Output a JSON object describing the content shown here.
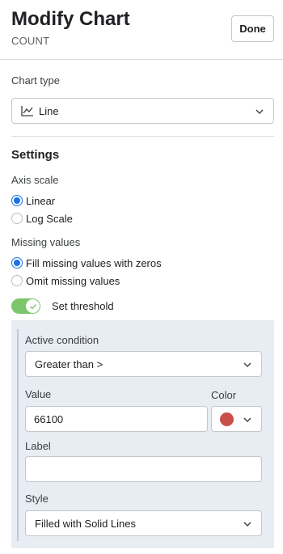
{
  "header": {
    "title": "Modify Chart",
    "subtitle": "COUNT",
    "done_label": "Done"
  },
  "chart_type": {
    "label": "Chart type",
    "selected": "Line",
    "icon": "line-chart-icon"
  },
  "settings": {
    "title": "Settings",
    "axis_scale": {
      "label": "Axis scale",
      "options": [
        "Linear",
        "Log Scale"
      ],
      "selected": "Linear"
    },
    "missing_values": {
      "label": "Missing values",
      "options": [
        "Fill missing values with zeros",
        "Omit missing values"
      ],
      "selected": "Fill missing values with zeros"
    },
    "threshold": {
      "toggle_label": "Set threshold",
      "enabled": true,
      "active_condition_label": "Active condition",
      "active_condition_value": "Greater than >",
      "value_label": "Value",
      "value": "66100",
      "color_label": "Color",
      "color": "#c9504a",
      "label_label": "Label",
      "label_value": "",
      "style_label": "Style",
      "style_value": "Filled with Solid Lines"
    }
  },
  "colors": {
    "accent": "#1a73e8",
    "toggle_on": "#7dc56a",
    "panel_bg": "#e8ecf3"
  }
}
